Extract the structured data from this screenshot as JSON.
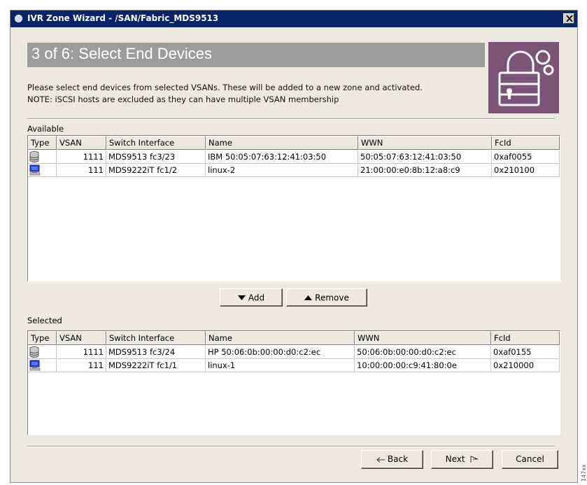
{
  "window": {
    "title": "IVR Zone Wizard - /SAN/Fabric_MDS9513",
    "close_icon": "close-icon"
  },
  "step": {
    "title": "3 of 6:  Select End Devices",
    "description_line1": "Please select end devices from selected VSANs. These will be added to a new zone and activated.",
    "description_line2": "NOTE: iSCSI hosts are excluded as they can have multiple VSAN membership",
    "icon": "lock-icon"
  },
  "available": {
    "label": "Available",
    "columns": [
      "Type",
      "VSAN",
      "Switch Interface",
      "Name",
      "WWN",
      "FcId"
    ],
    "rows": [
      {
        "type_icon": "storage-icon",
        "vsan": "1111",
        "switch_interface": "MDS9513 fc3/23",
        "name": "IBM 50:05:07:63:12:41:03:50",
        "wwn": "50:05:07:63:12:41:03:50",
        "fcid": "0xaf0055"
      },
      {
        "type_icon": "host-icon",
        "vsan": "111",
        "switch_interface": "MDS9222iT fc1/2",
        "name": "linux-2",
        "wwn": "21:00:00:e0:8b:12:a8:c9",
        "fcid": "0x210100"
      }
    ]
  },
  "actions": {
    "add_label": "Add",
    "remove_label": "Remove"
  },
  "selected": {
    "label": "Selected",
    "columns": [
      "Type",
      "VSAN",
      "Switch Interface",
      "Name",
      "WWN",
      "FcId"
    ],
    "rows": [
      {
        "type_icon": "storage-icon",
        "vsan": "1111",
        "switch_interface": "MDS9513 fc3/24",
        "name": "HP 50:06:0b:00:00:d0:c2:ec",
        "wwn": "50:06:0b:00:00:d0:c2:ec",
        "fcid": "0xaf0155"
      },
      {
        "type_icon": "host-icon",
        "vsan": "111",
        "switch_interface": "MDS9222iT fc1/1",
        "name": "linux-1",
        "wwn": "10:00:00:00:c9:41:80:0e",
        "fcid": "0x210000"
      }
    ]
  },
  "footer": {
    "back_label": "Back",
    "next_label": "Next",
    "cancel_label": "Cancel"
  },
  "figure_tag": "147xx"
}
